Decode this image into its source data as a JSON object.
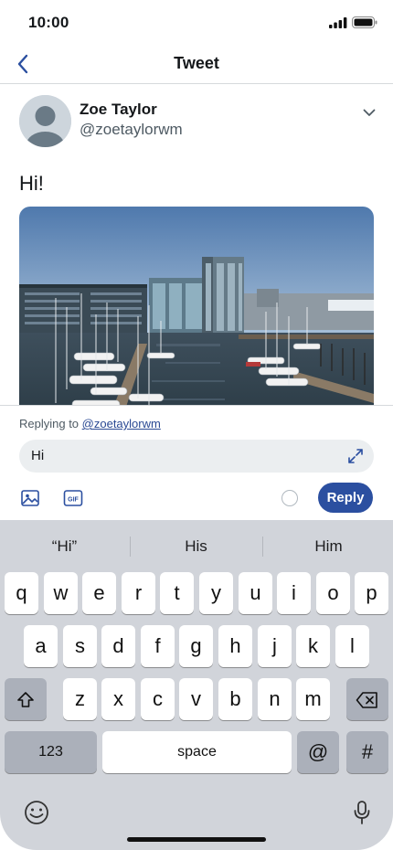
{
  "status_bar": {
    "time": "10:00"
  },
  "nav": {
    "title": "Tweet"
  },
  "tweet": {
    "author_name": "Zoe Taylor",
    "author_handle": "@zoetaylorwm",
    "text": "Hi!"
  },
  "reply": {
    "replying_prefix": "Replying to ",
    "replying_handle": "@zoetaylorwm",
    "input_value": "Hi",
    "button_label": "Reply"
  },
  "keyboard": {
    "suggestions": [
      "“Hi”",
      "His",
      "Him"
    ],
    "row1": [
      "q",
      "w",
      "e",
      "r",
      "t",
      "y",
      "u",
      "i",
      "o",
      "p"
    ],
    "row2": [
      "a",
      "s",
      "d",
      "f",
      "g",
      "h",
      "j",
      "k",
      "l"
    ],
    "row3": [
      "z",
      "x",
      "c",
      "v",
      "b",
      "n",
      "m"
    ],
    "numbers_key": "123",
    "space_key": "space",
    "at_key": "@",
    "hash_key": "#"
  },
  "colors": {
    "accent": "#2b4fa0",
    "keyboard_bg": "#d1d4da"
  },
  "icons": [
    "back-arrow",
    "chevron-down",
    "expand",
    "image",
    "gif",
    "shift",
    "backspace",
    "emoji",
    "microphone"
  ]
}
